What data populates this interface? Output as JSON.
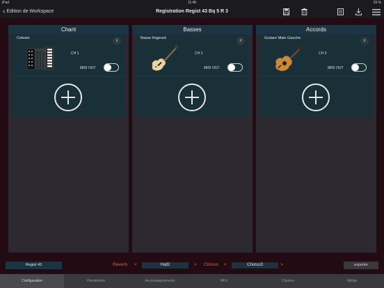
{
  "status": {
    "device": "iPad",
    "time": "11:48",
    "battery": "29 %"
  },
  "nav": {
    "back_label": "Edition de Workspace",
    "title": "Registration Regist 43 Bq 5 R 3",
    "icons": [
      "save-icon",
      "trash-icon",
      "document-icon",
      "download-icon",
      "menu-icon"
    ]
  },
  "columns": [
    {
      "title": "Chant",
      "instrument": "Celeste",
      "channel": "CH 1",
      "midi_label": "MIDI OUT",
      "close": "X",
      "icon": "accordion-icon"
    },
    {
      "title": "Basses",
      "instrument": "Basse fingered",
      "channel": "CH 2",
      "midi_label": "MIDI OUT",
      "close": "X",
      "icon": "bass-guitar-icon"
    },
    {
      "title": "Accords",
      "instrument": "Guitare Main Gauche",
      "channel": "CH 3",
      "midi_label": "MIDI OUT",
      "close": "X",
      "icon": "acoustic-guitar-icon"
    }
  ],
  "bottom": {
    "regist": "Regist 43",
    "reverb_label": "Reverb",
    "reverb_value": "Hall2",
    "chorus_label": "Chorus",
    "chorus_value": "Chorus3",
    "prev": "<",
    "next": ">",
    "export": "exporter"
  },
  "tabs": [
    "Configuration",
    "Paramètres",
    "Accompagnements",
    "MFX",
    "Claviers",
    "Média"
  ],
  "colors": {
    "accent": "#e8624a",
    "header": "#1d3442",
    "card": "#193038",
    "background": "#220b12"
  }
}
